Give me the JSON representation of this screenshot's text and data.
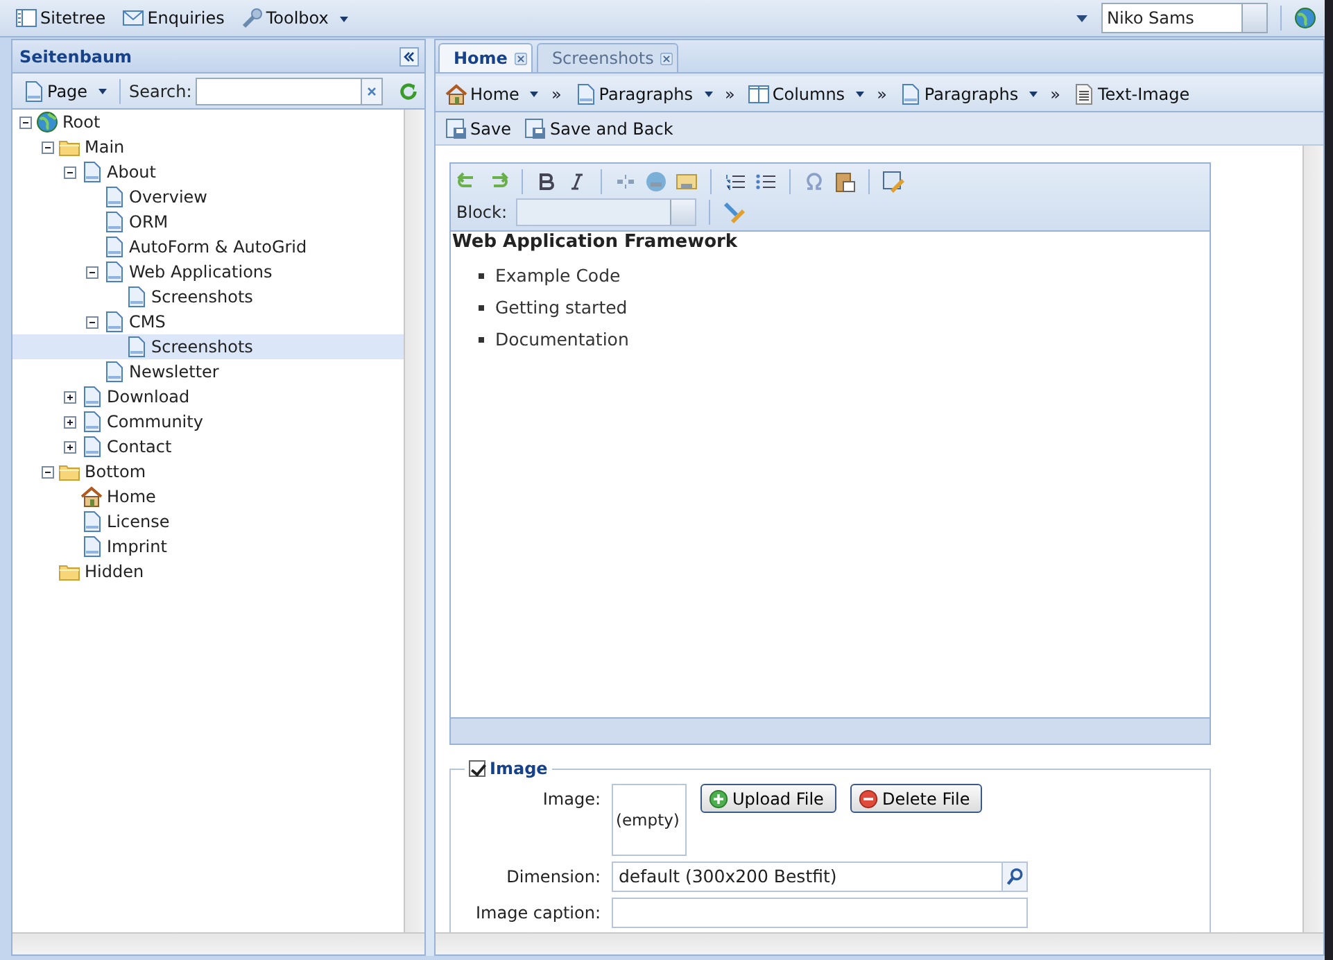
{
  "top_bar": {
    "items": [
      {
        "label": "Sitetree",
        "dropdown": false
      },
      {
        "label": "Enquiries",
        "dropdown": false
      },
      {
        "label": "Toolbox",
        "dropdown": true
      }
    ],
    "user_select": {
      "value": "Niko Sams"
    }
  },
  "sidebar": {
    "title": "Seitenbaum",
    "page_button": "Page",
    "search_label": "Search:",
    "tree": [
      {
        "label": "Root",
        "kind": "site",
        "expanded": true,
        "selected": false,
        "children": [
          {
            "label": "Main",
            "kind": "folder",
            "expanded": true,
            "selected": false,
            "children": [
              {
                "label": "About",
                "kind": "page",
                "expanded": true,
                "selected": false,
                "children": [
                  {
                    "label": "Overview",
                    "kind": "page",
                    "selected": false
                  },
                  {
                    "label": "ORM",
                    "kind": "page",
                    "selected": false
                  },
                  {
                    "label": "AutoForm & AutoGrid",
                    "kind": "page",
                    "selected": false
                  },
                  {
                    "label": "Web Applications",
                    "kind": "page",
                    "expanded": true,
                    "selected": false,
                    "children": [
                      {
                        "label": "Screenshots",
                        "kind": "page",
                        "selected": false
                      }
                    ]
                  },
                  {
                    "label": "CMS",
                    "kind": "page",
                    "expanded": true,
                    "selected": false,
                    "children": [
                      {
                        "label": "Screenshots",
                        "kind": "page",
                        "selected": true
                      }
                    ]
                  },
                  {
                    "label": "Newsletter",
                    "kind": "page",
                    "selected": false
                  }
                ]
              },
              {
                "label": "Download",
                "kind": "page",
                "expanded": false,
                "selected": false
              },
              {
                "label": "Community",
                "kind": "page",
                "expanded": false,
                "selected": false
              },
              {
                "label": "Contact",
                "kind": "page",
                "expanded": false,
                "selected": false
              }
            ]
          },
          {
            "label": "Bottom",
            "kind": "folder",
            "expanded": true,
            "selected": false,
            "children": [
              {
                "label": "Home",
                "kind": "home",
                "selected": false
              },
              {
                "label": "License",
                "kind": "page",
                "selected": false
              },
              {
                "label": "Imprint",
                "kind": "page",
                "selected": false
              }
            ]
          },
          {
            "label": "Hidden",
            "kind": "folder",
            "selected": false
          }
        ]
      }
    ]
  },
  "tabs": [
    {
      "label": "Home",
      "selected": true
    },
    {
      "label": "Screenshots",
      "selected": false
    }
  ],
  "breadcrumb": [
    {
      "kind": "home",
      "label": "Home",
      "dropdown": true
    },
    {
      "kind": "separator",
      "label": "»"
    },
    {
      "kind": "page",
      "label": "Paragraphs",
      "dropdown": true
    },
    {
      "kind": "separator",
      "label": "»"
    },
    {
      "kind": "columns",
      "label": "Columns",
      "dropdown": true
    },
    {
      "kind": "separator",
      "label": "»"
    },
    {
      "kind": "page",
      "label": "Paragraphs",
      "dropdown": true
    },
    {
      "kind": "separator",
      "label": "»"
    },
    {
      "kind": "text",
      "label": "Text-Image",
      "dropdown": false
    }
  ],
  "actions": [
    "Save",
    "Save and Back"
  ],
  "editor": {
    "block_label": "Block:",
    "heading": "Web Application Framework",
    "bullets": [
      "Example Code",
      "Getting started",
      "Documentation"
    ]
  },
  "image_section": {
    "legend": "Image",
    "checked": true,
    "image_label": "Image:",
    "image_value": "(empty)",
    "buttons": [
      {
        "label": "Upload File",
        "kind": "add"
      },
      {
        "label": "Delete File",
        "kind": "remove"
      }
    ],
    "dimension_label": "Dimension:",
    "dimension_value": "default (300x200 Bestfit)",
    "caption_label": "Image caption:"
  }
}
